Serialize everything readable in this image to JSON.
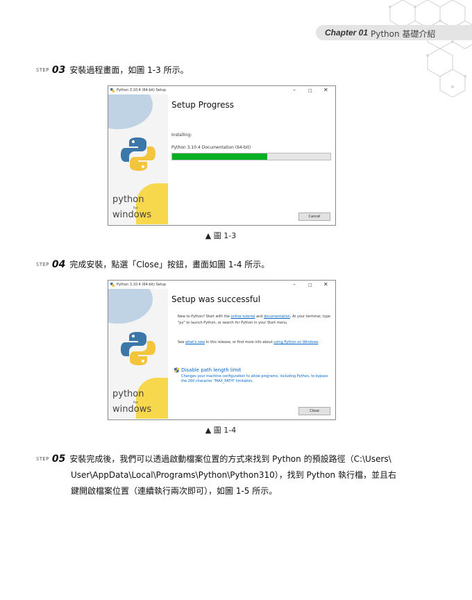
{
  "header": {
    "chapter_label": "Chapter 01",
    "chapter_title": "Python 基礎介紹"
  },
  "step3": {
    "tag": "STEP",
    "number": "03",
    "text": "安裝過程畫面，如圖 1-3 所示。"
  },
  "dialog1": {
    "title": "Python 3.10.4 (64-bit) Setup",
    "heading": "Setup Progress",
    "installing_label": "Installing:",
    "current_item": "Python 3.10.4 Documentation (64-bit)",
    "progress": 0.6,
    "cancel_label": "Cancel",
    "sidebar_python": "python",
    "sidebar_for": "for",
    "sidebar_windows": "windows"
  },
  "caption1": "▲ 圖 1-3",
  "step4": {
    "tag": "STEP",
    "number": "04",
    "text": "完成安裝，點選「Close」按鈕，畫面如圖 1-4 所示。"
  },
  "dialog2": {
    "title": "Python 3.10.4 (64-bit) Setup",
    "heading": "Setup was successful",
    "p1_a": "New to Python? Start with the ",
    "p1_link1": "online tutorial",
    "p1_b": " and ",
    "p1_link2": "documentation",
    "p1_c": ". At your terminal, type \"py\" to launch Python, or search for Python in your Start menu.",
    "p2_a": "See ",
    "p2_link1": "what's new",
    "p2_b": " in this release, or find more info about ",
    "p2_link2": "using Python on Windows",
    "p2_c": ".",
    "disable_label": "Disable path length limit",
    "disable_desc": "Changes your machine configuration to allow programs, including Python, to bypass the 260 character \"MAX_PATH\" limitation.",
    "close_label": "Close",
    "sidebar_python": "python",
    "sidebar_for": "for",
    "sidebar_windows": "windows"
  },
  "caption2": "▲ 圖 1-4",
  "step5": {
    "tag": "STEP",
    "number": "05",
    "line1": "安裝完成後，我們可以透過啟動檔案位置的方式來找到 Python 的預設路徑（C:\\Users\\",
    "line2": "User\\AppData\\Local\\Programs\\Python\\Python310），找到 Python 執行檔，並且右",
    "line3": "鍵開啟檔案位置（連續執行兩次即可），如圖 1-5 所示。"
  }
}
